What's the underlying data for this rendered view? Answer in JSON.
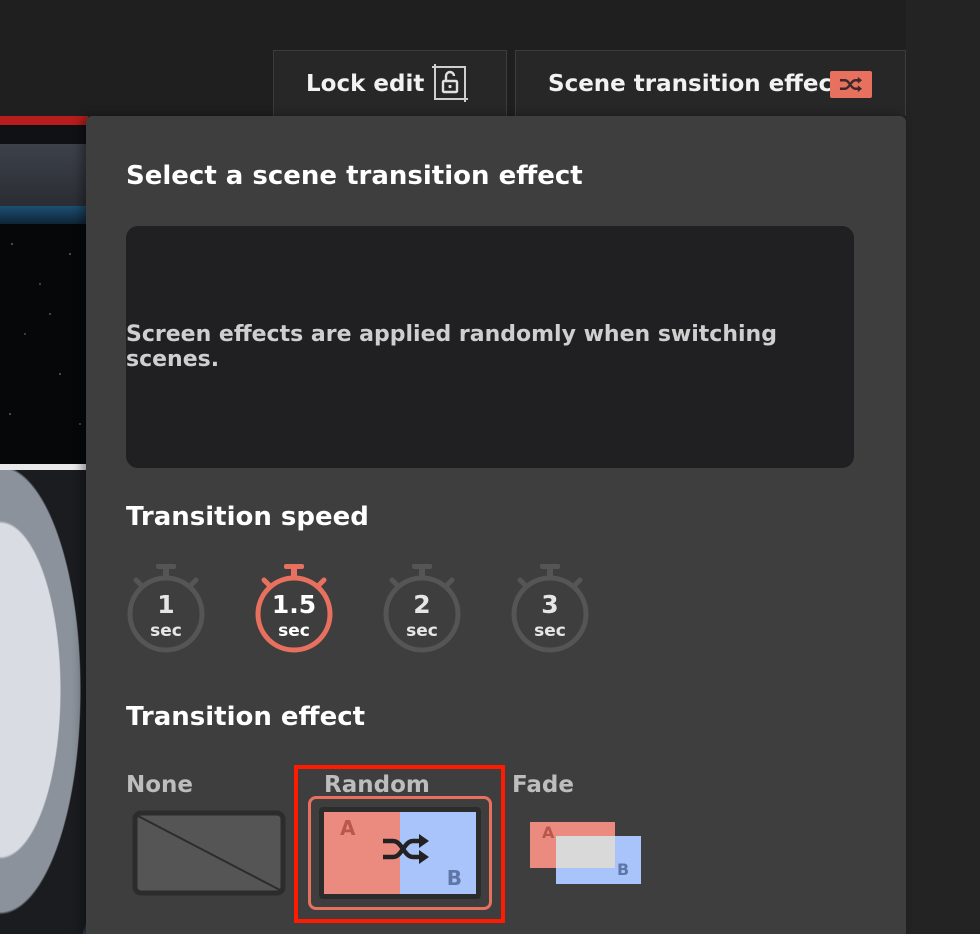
{
  "toolbar": {
    "lock_edit_label": "Lock edit",
    "scene_transition_label": "Scene transition effect",
    "accent_color": "#e8705f"
  },
  "panel": {
    "title": "Select a scene transition effect",
    "description": "Screen effects are applied randomly when switching scenes.",
    "speed_title": "Transition speed",
    "speed_options": [
      {
        "value": "1",
        "unit": "sec",
        "selected": false
      },
      {
        "value": "1.5",
        "unit": "sec",
        "selected": true
      },
      {
        "value": "2",
        "unit": "sec",
        "selected": false
      },
      {
        "value": "3",
        "unit": "sec",
        "selected": false
      }
    ],
    "effect_title": "Transition effect",
    "effects": [
      {
        "label": "None",
        "selected": false
      },
      {
        "label": "Random",
        "selected": true,
        "thumb_a": "A",
        "thumb_b": "B"
      },
      {
        "label": "Fade",
        "selected": false,
        "thumb_a": "A",
        "thumb_b": "B"
      }
    ]
  },
  "icons": [
    "unlock-icon",
    "shuffle-icon",
    "stopwatch-icon"
  ]
}
